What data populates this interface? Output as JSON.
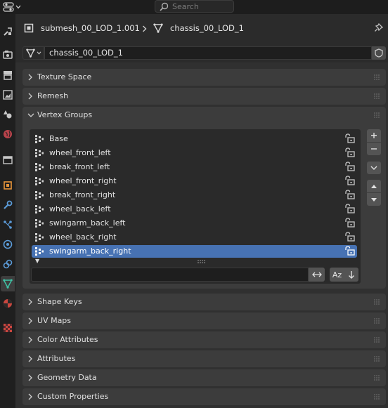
{
  "search": {
    "placeholder": "Search"
  },
  "header": {
    "object_name": "submesh_00_LOD_1.001",
    "mesh_name": "chassis_00_LOD_1",
    "separator": ">"
  },
  "datablock": {
    "name": "chassis_00_LOD_1"
  },
  "panels": {
    "texture_space": "Texture Space",
    "remesh": "Remesh",
    "vertex_groups": "Vertex Groups",
    "shape_keys": "Shape Keys",
    "uv_maps": "UV Maps",
    "color_attributes": "Color Attributes",
    "attributes": "Attributes",
    "geometry_data": "Geometry Data",
    "custom_properties": "Custom Properties"
  },
  "vertex_groups": {
    "items": [
      {
        "name": "Base"
      },
      {
        "name": "wheel_front_left"
      },
      {
        "name": "break_front_left"
      },
      {
        "name": "wheel_front_right"
      },
      {
        "name": "break_front_right"
      },
      {
        "name": "wheel_back_left"
      },
      {
        "name": "swingarm_back_left"
      },
      {
        "name": "wheel_back_right"
      },
      {
        "name": "swingarm_back_right"
      }
    ],
    "selected": "swingarm_back_right",
    "filter_value": "",
    "sort_alpha_label": "Az"
  },
  "colors": {
    "selection": "#4772b3",
    "mesh_tab": "#3fc3a6",
    "panel_bg": "#3c3c3c"
  },
  "icons": {
    "editor_type": "properties-icon",
    "tabs": [
      "tool-icon",
      "render-icon",
      "output-icon",
      "view-layer-icon",
      "scene-icon",
      "world-icon",
      "collection-icon",
      "object-icon",
      "modifier-icon",
      "particles-icon",
      "physics-icon",
      "constraints-icon",
      "mesh-data-icon",
      "material-icon",
      "texture-icon"
    ]
  }
}
